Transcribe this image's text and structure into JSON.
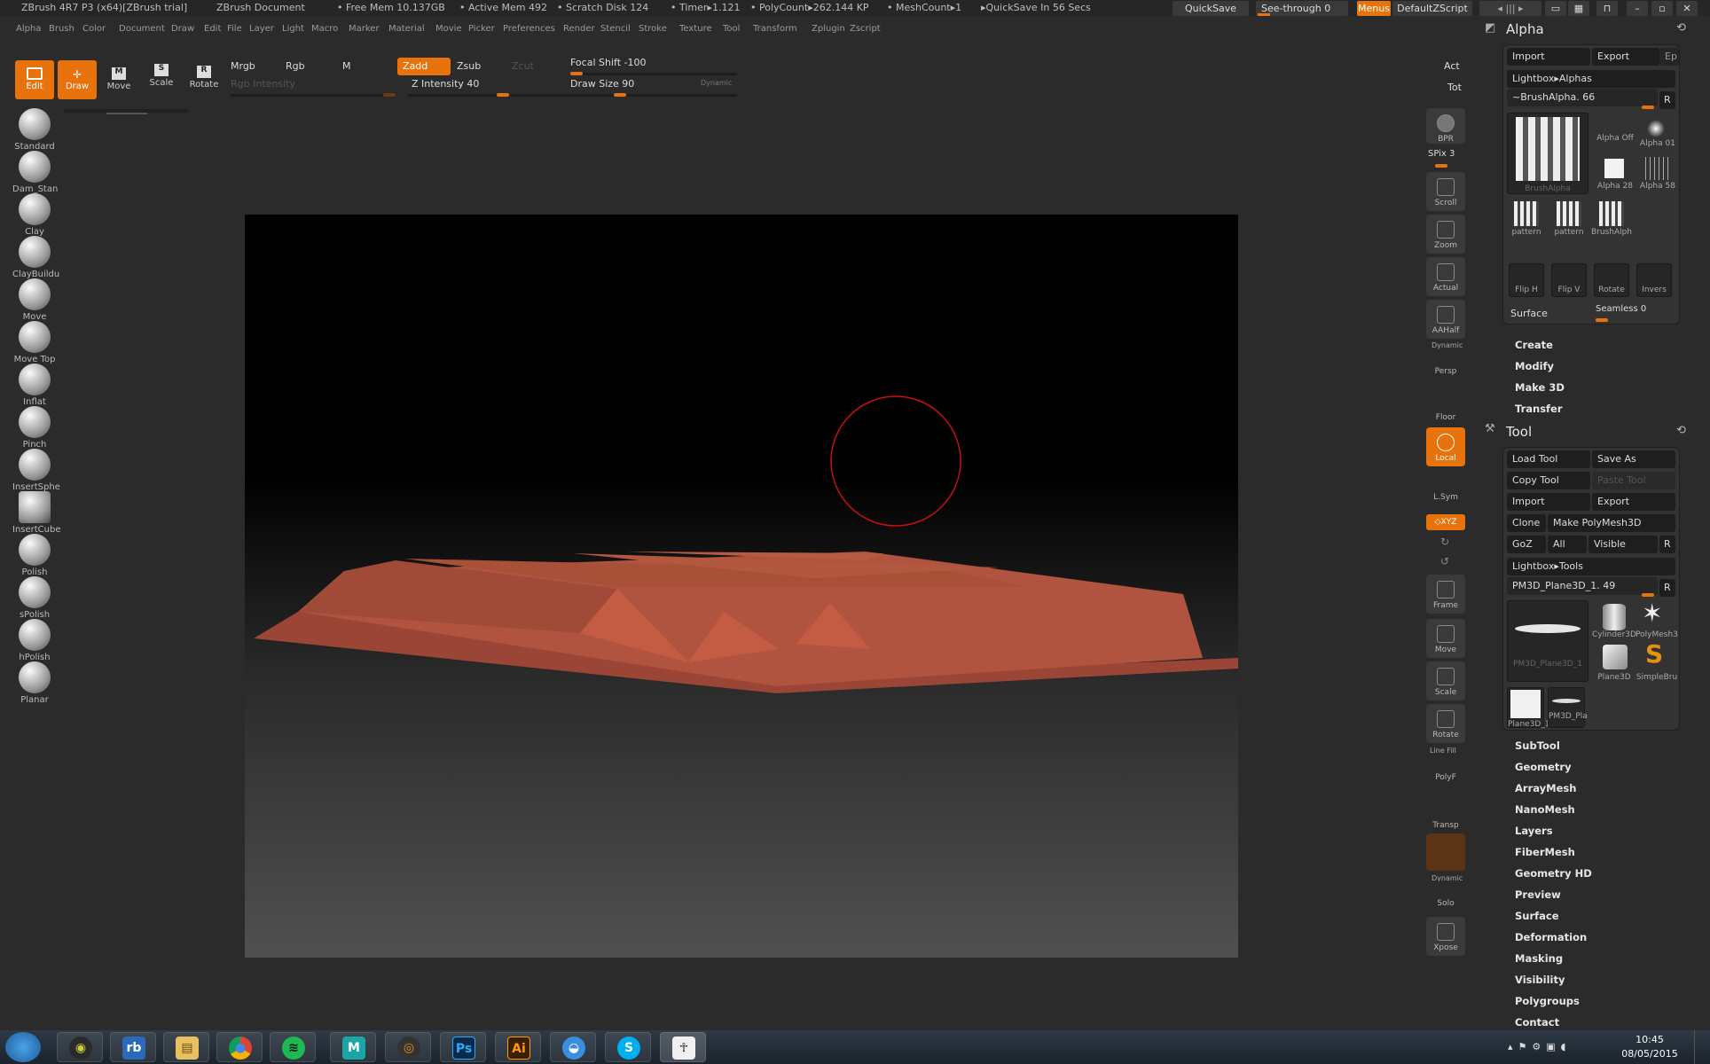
{
  "titlebar": {
    "app": "ZBrush 4R7 P3 (x64)[ZBrush trial]",
    "document": "ZBrush Document",
    "free_mem": "• Free Mem 10.137GB",
    "active_mem": "• Active Mem 492",
    "scratch": "• Scratch Disk 124",
    "timer": "• Timer▸1.121",
    "polycount": "• PolyCount▸262.144 KP",
    "meshcount": "• MeshCount▸1",
    "quicksave_status": "▸QuickSave In 56 Secs",
    "quicksave_btn": "QuickSave",
    "see_through": "See-through  0",
    "menus": "Menus",
    "script": "DefaultZScript"
  },
  "menu": [
    "Alpha",
    "Brush",
    "Color",
    "Document",
    "Draw",
    "Edit",
    "File",
    "Layer",
    "Light",
    "Macro",
    "Marker",
    "Material",
    "Movie",
    "Picker",
    "Preferences",
    "Render",
    "Stencil",
    "Stroke",
    "Texture",
    "Tool",
    "Transform",
    "Zplugin",
    "Zscript"
  ],
  "shelf": {
    "edit": "Edit",
    "draw": "Draw",
    "move": "Move",
    "scale": "Scale",
    "rotate": "Rotate",
    "mrgb": "Mrgb",
    "rgb": "Rgb",
    "m": "M",
    "rgb_intensity": "Rgb Intensity",
    "zadd": "Zadd",
    "zsub": "Zsub",
    "zcut": "Zcut",
    "z_intensity": "Z Intensity 40",
    "focal_shift": "Focal Shift -100",
    "draw_size": "Draw Size 90",
    "dynamic": "Dynamic",
    "act": "Act",
    "tot": "Tot"
  },
  "brushes": [
    "Standard",
    "Dam_Stan",
    "Clay",
    "ClayBuildu",
    "Move",
    "Move Top",
    "Inflat",
    "Pinch",
    "InsertSphe",
    "InsertCube",
    "Polish",
    "sPolish",
    "hPolish",
    "Planar"
  ],
  "rightshelf": {
    "bpr": "BPR",
    "spix": "SPix 3",
    "scroll": "Scroll",
    "zoom": "Zoom",
    "actual": "Actual",
    "aahalf": "AAHalf",
    "dynamic": "Dynamic",
    "persp": "Persp",
    "floor": "Floor",
    "local": "Local",
    "lsym": "L.Sym",
    "xyz": "◇XYZ",
    "frame": "Frame",
    "move": "Move",
    "scale": "Scale",
    "rotate": "Rotate",
    "linefill": "Line Fill",
    "polyf": "PolyF",
    "transp": "Transp",
    "dynamic2": "Dynamic",
    "solo": "Solo",
    "xpose": "Xpose"
  },
  "alpha_panel": {
    "title": "Alpha",
    "import": "Import",
    "export": "Export",
    "ep": "Ep",
    "lightbox": "Lightbox▸Alphas",
    "brushalpha": "~BrushAlpha. 66",
    "r": "R",
    "main_thumb": "BrushAlpha",
    "thumbs": [
      "Alpha Off",
      "Alpha 01",
      "Alpha 28",
      "Alpha 58",
      "pattern",
      "pattern",
      "BrushAlph"
    ],
    "flip_h": "Flip H",
    "flip_v": "Flip V",
    "rotate": "Rotate",
    "invers": "Invers",
    "surface": "Surface",
    "seamless": "Seamless 0",
    "sections": [
      "Create",
      "Modify",
      "Make 3D",
      "Transfer"
    ]
  },
  "tool_panel": {
    "title": "Tool",
    "load_tool": "Load Tool",
    "save_as": "Save As",
    "copy_tool": "Copy Tool",
    "paste_tool": "Paste Tool",
    "import": "Import",
    "export": "Export",
    "clone": "Clone",
    "make_polymesh": "Make PolyMesh3D",
    "goz": "GoZ",
    "all": "All",
    "visible": "Visible",
    "r": "R",
    "lightbox": "Lightbox▸Tools",
    "current": "PM3D_Plane3D_1. 49",
    "main_thumb": "PM3D_Plane3D_1",
    "thumbs": [
      "Cylinder3D",
      "PolyMesh3",
      "Plane3D",
      "SimpleBru",
      "Plane3D_1",
      "PM3D_Pla"
    ],
    "sections": [
      "SubTool",
      "Geometry",
      "ArrayMesh",
      "NanoMesh",
      "Layers",
      "FiberMesh",
      "Geometry HD",
      "Preview",
      "Surface",
      "Deformation",
      "Masking",
      "Visibility",
      "Polygroups",
      "Contact"
    ]
  },
  "taskbar": {
    "apps": [
      "windows-start",
      "zbrush",
      "rb",
      "explorer",
      "chrome",
      "spotify",
      "maya",
      "blender",
      "photoshop",
      "illustrator",
      "chat",
      "skype",
      "zbrush-app"
    ],
    "ps": "Ps",
    "ai": "Ai",
    "rb": "rb",
    "time": "10:45",
    "date": "08/05/2015"
  },
  "colors": {
    "accent": "#e8730c",
    "model": "#b0533f",
    "brush_ring": "#c81010"
  }
}
